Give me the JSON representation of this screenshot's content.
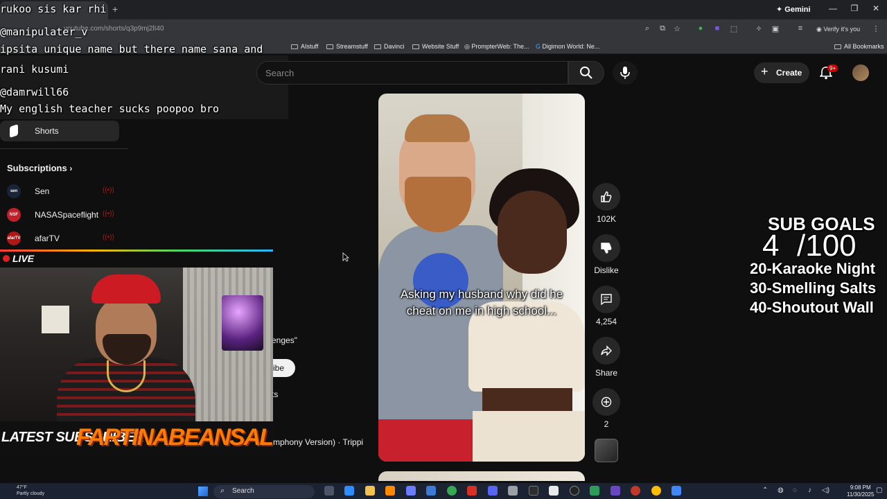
{
  "browser": {
    "tab_title": "rukoo sis kar rhi",
    "url": "youtube.com/shorts/q3p9mj2lI40",
    "gemini_label": "Gemini",
    "profile_label": "Verify it's you",
    "bookmarks": [
      "AIstuff",
      "Streamstuff",
      "Davinci",
      "Website Stuff",
      "PrompterWeb: The...",
      "Digimon World: Ne..."
    ],
    "all_bookmarks": "All Bookmarks"
  },
  "youtube": {
    "search_placeholder": "Search",
    "create_label": "Create",
    "notification_count": "9+",
    "nav_shorts": "Shorts",
    "subscriptions_title": "Subscriptions",
    "subscriptions": [
      {
        "name": "Sen",
        "avatar_text": "sen",
        "color": "#1a2438"
      },
      {
        "name": "NASASpaceflight",
        "avatar_text": "NSF",
        "color": "#c0202a"
      },
      {
        "name": "afarTV",
        "avatar_text": "afarTV",
        "color": "#b01818"
      }
    ],
    "partial_behind": {
      "challenges": "enges\"",
      "subscribe": "ribe",
      "shorts": "ts",
      "song": "mphony Version) · Trippi"
    }
  },
  "video": {
    "caption": "Asking my husband why did he cheat on me in high school...",
    "likes": "102K",
    "dislike_label": "Dislike",
    "comments": "4,254",
    "share_label": "Share",
    "remix_count": "2"
  },
  "overlay": {
    "chat": [
      "rukoo sis kar rhi",
      "@manipulater_v",
      "ipsita unique name but there name sana and",
      "rani kusumi",
      "@damrwill66",
      "My english teacher sucks poopoo bro"
    ],
    "live_label": "LIVE",
    "latest_sub_label": "LATEST SUBSCRIBER",
    "latest_sub_name": "FARTINABEANSALO",
    "goals_title": "SUB GOALS",
    "goals_current": "4",
    "goals_target": "/100",
    "goals": [
      "20-Karaoke Night",
      "30-Smelling Salts",
      "40-Shoutout Wall"
    ]
  },
  "taskbar": {
    "temp": "47°F",
    "weather": "Partly cloudy",
    "search_label": "Search",
    "time": "9:08 PM",
    "date": "11/30/2025"
  }
}
